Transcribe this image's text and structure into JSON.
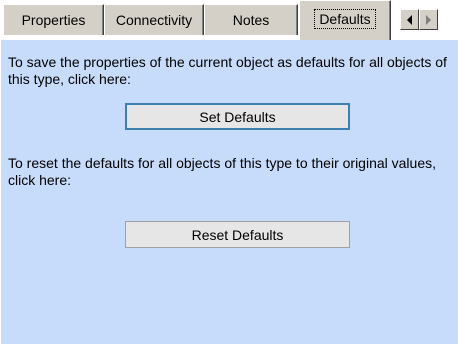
{
  "tabs": [
    {
      "label": "Properties"
    },
    {
      "label": "Connectivity"
    },
    {
      "label": "Notes"
    },
    {
      "label": "Defaults"
    }
  ],
  "active_tab": "Defaults",
  "scroll_icons": [
    "scroll-left-icon",
    "scroll-right-icon"
  ],
  "defaults": {
    "save_text": "To save the properties of the current object as defaults for all objects of this type, click here:",
    "set_button": "Set Defaults",
    "reset_text": "To reset the defaults for all objects of this type to their original values, click here:",
    "reset_button": "Reset Defaults"
  },
  "colors": {
    "panel_background": "#c7dcfa",
    "tab_face": "#d4d0c8",
    "button_face": "#e6e6e6",
    "default_button_border": "#3c7fb1"
  }
}
